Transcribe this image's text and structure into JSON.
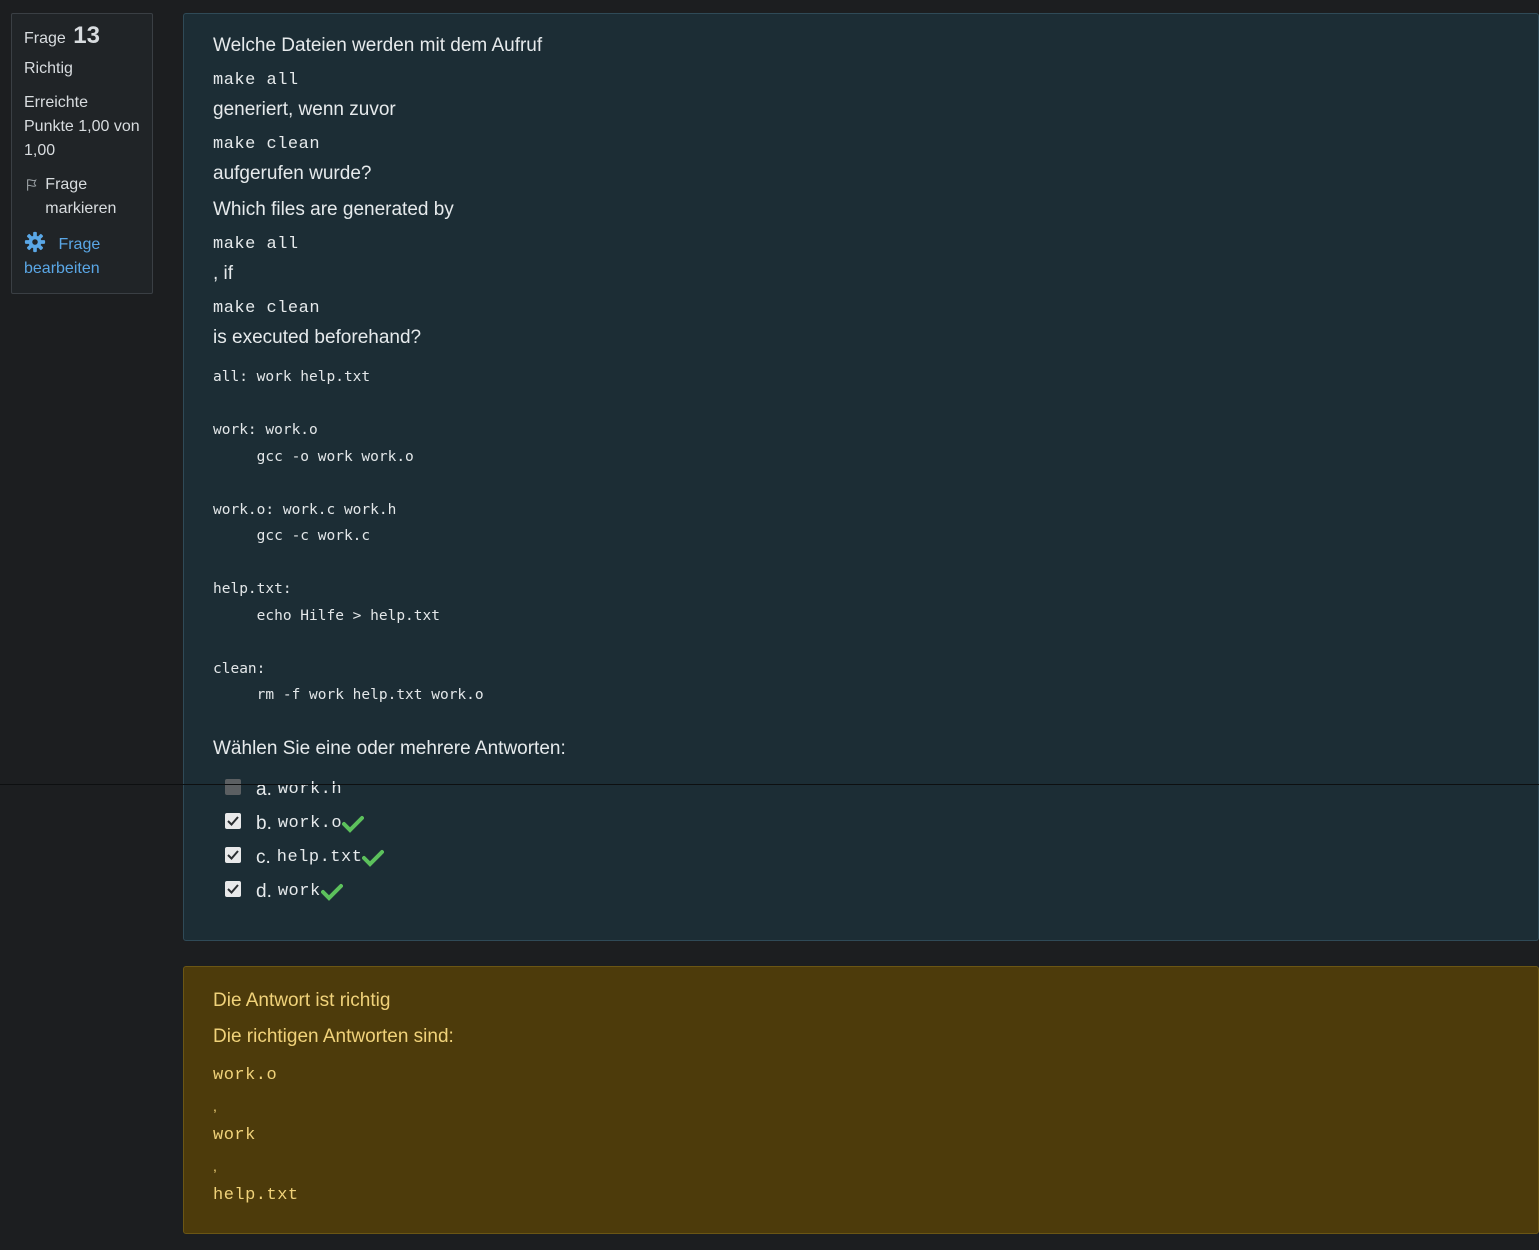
{
  "info": {
    "question_label": "Frage",
    "question_number": "13",
    "state": "Richtig",
    "grade": "Erreichte Punkte 1,00 von 1,00",
    "flag_label": "Frage markieren",
    "edit_label": "Frage bearbeiten"
  },
  "question": {
    "de_intro": "Welche Dateien werden mit dem Aufruf",
    "cmd_all": "make all",
    "de_mid": "generiert, wenn zuvor",
    "cmd_clean": "make clean",
    "de_end": "aufgerufen wurde?",
    "en_intro": "Which files are generated by",
    "en_mid": ", if",
    "en_end": "is executed beforehand?",
    "makefile": "all: work help.txt\n\nwork: work.o\n     gcc -o work work.o\n\nwork.o: work.c work.h\n     gcc -c work.c\n\nhelp.txt:\n     echo Hilfe > help.txt\n\nclean:\n     rm -f work help.txt work.o",
    "prompt": "Wählen Sie eine oder mehrere Antworten:",
    "answers": [
      {
        "letter": "a.",
        "value": "work.h",
        "checked": false,
        "correct": false
      },
      {
        "letter": "b.",
        "value": "work.o",
        "checked": true,
        "correct": true
      },
      {
        "letter": "c.",
        "value": "help.txt",
        "checked": true,
        "correct": true
      },
      {
        "letter": "d.",
        "value": "work",
        "checked": true,
        "correct": true
      }
    ]
  },
  "feedback": {
    "status": "Die Antwort ist richtig",
    "right_answer_label": "Die richtigen Antworten sind:",
    "right_answers": [
      "work.o",
      "work",
      "help.txt"
    ],
    "separator": ","
  },
  "colors": {
    "background": "#1c1e20",
    "question_bg": "#1c2d35",
    "feedback_bg": "#4d3b0b",
    "feedback_text": "#f0d27a",
    "correct_tick": "#5cc15c",
    "link": "#5aa7e6"
  }
}
